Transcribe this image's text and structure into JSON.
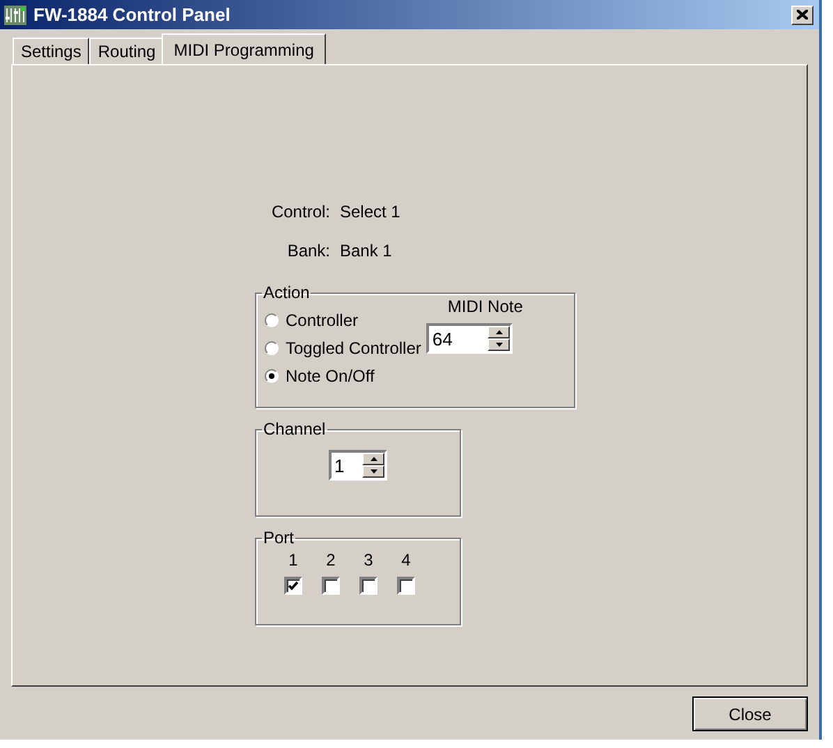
{
  "window": {
    "title": "FW-1884 Control Panel"
  },
  "tabs": [
    {
      "label": "Settings",
      "selected": false
    },
    {
      "label": "Routing",
      "selected": false
    },
    {
      "label": "MIDI Programming",
      "selected": true
    }
  ],
  "info": [
    {
      "label": "Control:",
      "value": "Select 1"
    },
    {
      "label": "Bank:",
      "value": "Bank 1"
    }
  ],
  "action": {
    "title": "Action",
    "options": [
      {
        "label": "Controller",
        "selected": false
      },
      {
        "label": "Toggled Controller",
        "selected": false
      },
      {
        "label": "Note On/Off",
        "selected": true
      }
    ],
    "midi_note": {
      "label": "MIDI Note",
      "value": "64"
    }
  },
  "channel": {
    "title": "Channel",
    "value": "1"
  },
  "port": {
    "title": "Port",
    "ports": [
      {
        "label": "1",
        "checked": true
      },
      {
        "label": "2",
        "checked": false
      },
      {
        "label": "3",
        "checked": false
      },
      {
        "label": "4",
        "checked": false
      }
    ]
  },
  "buttons": [
    "Close"
  ]
}
